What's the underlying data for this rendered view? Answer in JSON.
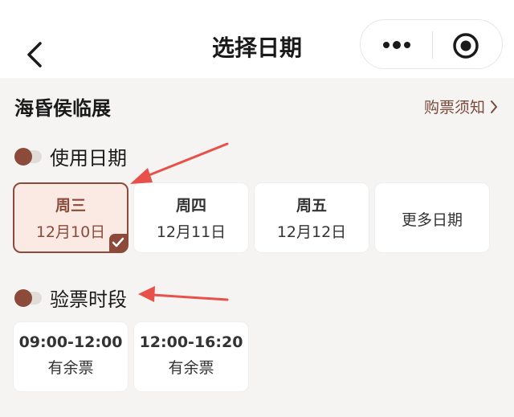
{
  "nav": {
    "title": "选择日期"
  },
  "exhibit": {
    "title": "海昏侯临展",
    "notice_label": "购票须知"
  },
  "date_section": {
    "title": "使用日期",
    "dates": [
      {
        "weekday": "周三",
        "date": "12月10日",
        "selected": true
      },
      {
        "weekday": "周四",
        "date": "12月11日",
        "selected": false
      },
      {
        "weekday": "周五",
        "date": "12月12日",
        "selected": false
      }
    ],
    "more_label": "更多日期"
  },
  "time_section": {
    "title": "验票时段",
    "slots": [
      {
        "time": "09:00-12:00",
        "status": "有余票"
      },
      {
        "time": "12:00-16:20",
        "status": "有余票"
      }
    ]
  },
  "colors": {
    "accent": "#8b4a3a",
    "selected_bg": "#fbe9e4",
    "annotation_arrow": "#e8504a"
  }
}
